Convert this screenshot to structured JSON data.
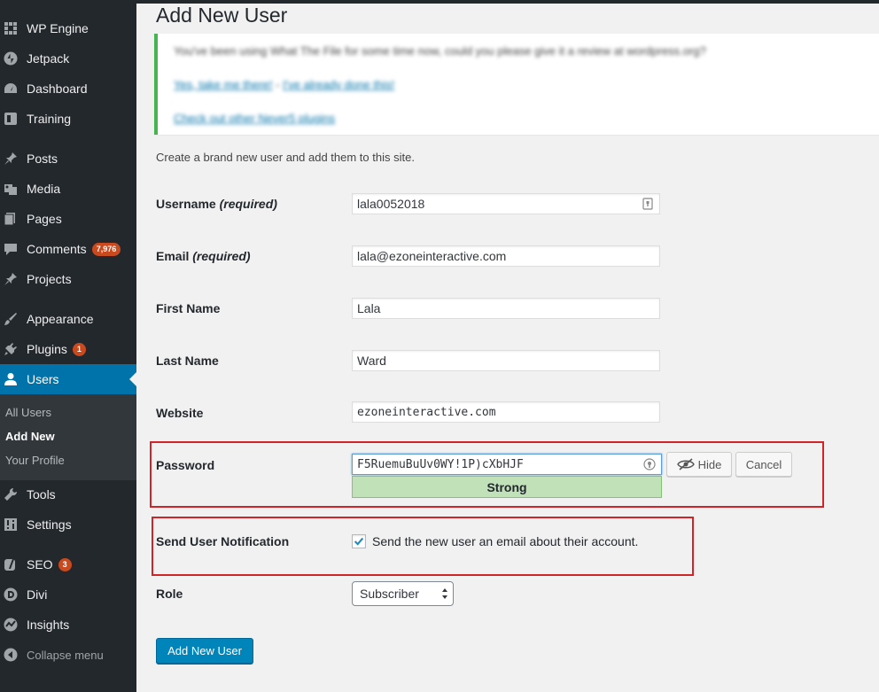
{
  "sidebar": {
    "items": [
      {
        "label": "WP Engine",
        "icon": "wp-engine-icon"
      },
      {
        "label": "Jetpack",
        "icon": "jetpack-icon"
      },
      {
        "label": "Dashboard",
        "icon": "dashboard-icon"
      },
      {
        "label": "Training",
        "icon": "training-icon"
      },
      {
        "label": "Posts",
        "icon": "pin-icon"
      },
      {
        "label": "Media",
        "icon": "media-icon"
      },
      {
        "label": "Pages",
        "icon": "pages-icon"
      },
      {
        "label": "Comments",
        "icon": "comments-icon",
        "badge": "7,976"
      },
      {
        "label": "Projects",
        "icon": "pin-icon"
      },
      {
        "label": "Appearance",
        "icon": "brush-icon"
      },
      {
        "label": "Plugins",
        "icon": "plugin-icon",
        "badge": "1"
      },
      {
        "label": "Users",
        "icon": "user-icon"
      },
      {
        "label": "Tools",
        "icon": "wrench-icon"
      },
      {
        "label": "Settings",
        "icon": "settings-icon"
      },
      {
        "label": "SEO",
        "icon": "yoast-icon",
        "badge": "3"
      },
      {
        "label": "Divi",
        "icon": "divi-icon"
      },
      {
        "label": "Insights",
        "icon": "insights-icon"
      }
    ],
    "submenu": [
      "All Users",
      "Add New",
      "Your Profile"
    ],
    "collapse_label": "Collapse menu"
  },
  "page": {
    "title": "Add New User",
    "intro": "Create a brand new user and add them to this site."
  },
  "notice": {
    "line1": "You've been using What The File for some time now, could you please give it a review at wordpress.org?",
    "link1": "Yes, take me there!",
    "sep": "-",
    "link2": "I've already done this!",
    "link3": "Check out other Never5 plugins"
  },
  "form": {
    "username_label": "Username",
    "username_req": "(required)",
    "username": "lala0052018",
    "email_label": "Email",
    "email_req": "(required)",
    "email": "lala@ezoneinteractive.com",
    "first_name_label": "First Name",
    "first_name": "Lala",
    "last_name_label": "Last Name",
    "last_name": "Ward",
    "website_label": "Website",
    "website": "ezoneinteractive.com",
    "password_label": "Password",
    "password": "F5RuemuBuUv0WY!1P)cXbHJF",
    "strength": "Strong",
    "hide_label": "Hide",
    "cancel_label": "Cancel",
    "notify_label": "Send User Notification",
    "notify_text": "Send the new user an email about their account.",
    "notify_checked": true,
    "role_label": "Role",
    "role": "Subscriber",
    "submit_label": "Add New User"
  },
  "colors": {
    "sidebar_bg": "#23282d",
    "active_bg": "#0073aa",
    "badge": "#ca4a1f",
    "primary": "#0085ba",
    "highlight_box": "#d0242b",
    "strength_bg": "#c1e1b9"
  }
}
